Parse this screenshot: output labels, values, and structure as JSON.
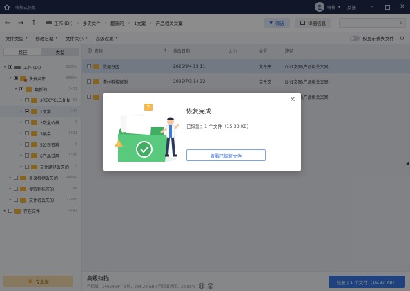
{
  "titlebar": {
    "app_title": "嗨格式恢复",
    "user_name": "嗨格",
    "help": "反馈",
    "minimize_icon": "minus",
    "restore_icon": "square",
    "close_icon": "x"
  },
  "nav": {
    "breadcrumb": [
      "工作 (D:)",
      "多夹文件",
      "翻新的",
      "1文案",
      "产品相关文案"
    ],
    "filter_label": "筛选",
    "detail_label": "详细信息",
    "search_placeholder": ""
  },
  "toolbar": {
    "dropdowns": [
      "文件类型",
      "修改日期",
      "文件大小",
      "高级过滤"
    ],
    "toggle_label": "仅显示丢失文件"
  },
  "left": {
    "tabs": [
      "路径",
      "类型"
    ],
    "tree": [
      {
        "label": "工作 (D:)",
        "count": "9005+",
        "level": 0,
        "kind": "disk",
        "expanded": true
      },
      {
        "label": "多夹文件",
        "count": "9999+",
        "level": 1,
        "kind": "red",
        "expanded": true
      },
      {
        "label": "翻新的",
        "count": "3451",
        "level": 2,
        "kind": "folder",
        "expanded": true
      },
      {
        "label": "$RECYCLE.BIN",
        "count": "51",
        "level": 3,
        "kind": "folder",
        "expanded": false
      },
      {
        "label": "1文案",
        "count": "144",
        "level": 3,
        "kind": "folder",
        "expanded": false,
        "selected": true
      },
      {
        "label": "2数量价格",
        "count": "3",
        "level": 3,
        "kind": "folder",
        "expanded": false
      },
      {
        "label": "3展会",
        "count": "1011",
        "level": 3,
        "kind": "folder",
        "expanded": false
      },
      {
        "label": "5公司资料",
        "count": "3",
        "level": 3,
        "kind": "folder",
        "expanded": false
      },
      {
        "label": "6产品试用",
        "count": "1190",
        "level": 3,
        "kind": "folder",
        "expanded": false
      },
      {
        "label": "文件路径丢失的",
        "count": "3",
        "level": 3,
        "kind": "folder",
        "expanded": false
      },
      {
        "label": "目录根据丢失的",
        "count": "9999+",
        "level": 1,
        "kind": "folder",
        "expanded": false
      },
      {
        "label": "搜取到标签的",
        "count": "66",
        "level": 1,
        "kind": "folder",
        "expanded": false
      },
      {
        "label": "文件名丢失的",
        "count": "27088",
        "level": 1,
        "kind": "folder",
        "expanded": false
      },
      {
        "label": "存在文件",
        "count": "4447",
        "level": 0,
        "kind": "folder",
        "expanded": false
      }
    ],
    "vip_label": "专业版"
  },
  "table": {
    "headers": {
      "name": "名称",
      "date": "修改日期",
      "size": "大小",
      "type": "类型",
      "path": "路径"
    },
    "rows": [
      {
        "name": "数据分区",
        "date": "2025/9/4 13:11",
        "size": "",
        "type": "文件夹",
        "path": "D:\\1文案\\产品相关文案",
        "highlight": true
      },
      {
        "name": "素材科技案例",
        "date": "2025/7/3 14:32",
        "size": "",
        "type": "文件夹",
        "path": "D:\\1文案\\产品相关文案",
        "highlight": false
      },
      {
        "name": "",
        "date": "",
        "size": "",
        "type": "",
        "path": "D:\\1文案\\产品相关文案",
        "highlight": false
      }
    ]
  },
  "bottom": {
    "scan_title": "高级扫描",
    "scan_info": "已扫描：3465464个文件，264.28 GB | 已扫描进度：28.88%",
    "recover_label": "恢复 | 1 个文件（15.33 KB）"
  },
  "dialog": {
    "title": "恢复完成",
    "status": "已恢复：1 个文件（15.33 KB）",
    "view_button": "查看已恢复文件",
    "illustration": "folder-with-person"
  },
  "colors": {
    "titlebar": "#1f2b49",
    "accent": "#3a78e6",
    "folder": "#f3b73e",
    "illustration_green": "#4cc26e"
  }
}
